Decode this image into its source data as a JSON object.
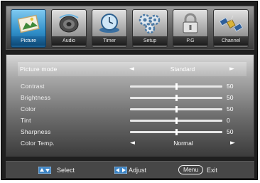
{
  "tabs": [
    {
      "label": "Picture",
      "icon": "picture-icon",
      "active": true
    },
    {
      "label": "Audio",
      "icon": "speaker-icon",
      "active": false
    },
    {
      "label": "Timer",
      "icon": "clock-icon",
      "active": false
    },
    {
      "label": "Setup",
      "icon": "gears-icon",
      "active": false
    },
    {
      "label": "P.G",
      "icon": "lock-icon",
      "active": false
    },
    {
      "label": "Channel",
      "icon": "satellite-icon",
      "active": false
    }
  ],
  "picture": {
    "mode": {
      "label": "Picture mode",
      "value": "Standard",
      "left_arrow": "◄",
      "right_arrow": "►"
    },
    "sliders": [
      {
        "label": "Contrast",
        "value": "50",
        "level": 0.5
      },
      {
        "label": "Brightness",
        "value": "50",
        "level": 0.5
      },
      {
        "label": "Color",
        "value": "50",
        "level": 0.5
      },
      {
        "label": "Tint",
        "value": "0",
        "level": 0.5
      },
      {
        "label": "Sharpness",
        "value": "50",
        "level": 0.5
      }
    ],
    "color_temp": {
      "label": "Color Temp.",
      "value": "Normal",
      "left_arrow": "◄",
      "right_arrow": "►"
    }
  },
  "help": {
    "select": "Select",
    "adjust": "Adjust",
    "menu_key": "Menu",
    "exit": "Exit"
  },
  "colors": {
    "active_tab": "#2f8ec8",
    "panel_top": "#d6d6d6",
    "panel_bottom": "#3c3c3c"
  }
}
